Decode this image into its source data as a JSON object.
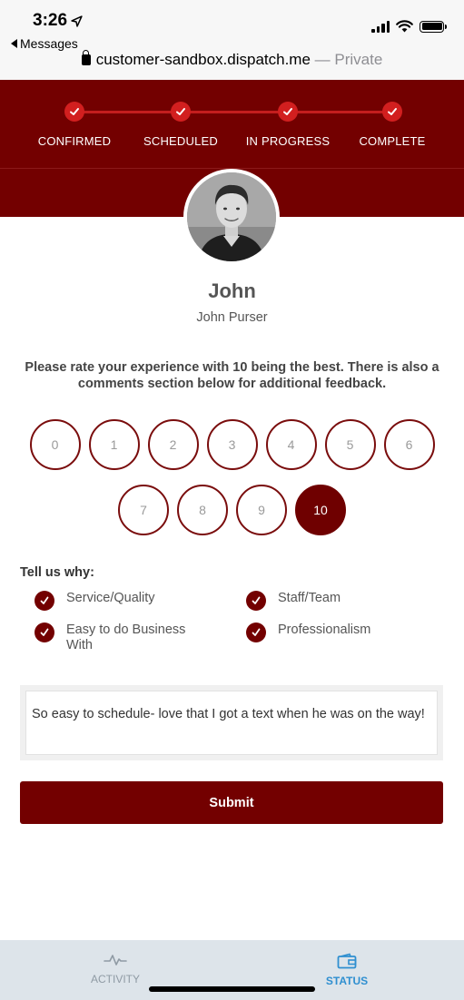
{
  "status_bar": {
    "time": "3:26",
    "back_app": "Messages",
    "url": "customer-sandbox.dispatch.me",
    "url_suffix": " — Private"
  },
  "progress": {
    "steps": [
      {
        "label": "CONFIRMED",
        "done": true
      },
      {
        "label": "SCHEDULED",
        "done": true
      },
      {
        "label": "IN PROGRESS",
        "done": true
      },
      {
        "label": "COMPLETE",
        "done": true
      }
    ]
  },
  "technician": {
    "first_name": "John",
    "full_name": "John Purser"
  },
  "survey": {
    "prompt": "Please rate your experience with 10 being the best. There is also a comments section below for additional feedback.",
    "ratings": [
      "0",
      "1",
      "2",
      "3",
      "4",
      "5",
      "6",
      "7",
      "8",
      "9",
      "10"
    ],
    "selected_rating": "10",
    "why_title": "Tell us why:",
    "reasons": [
      {
        "label": "Service/Quality",
        "checked": true
      },
      {
        "label": "Staff/Team",
        "checked": true
      },
      {
        "label": "Easy to do Business With",
        "checked": true
      },
      {
        "label": "Professionalism",
        "checked": true
      }
    ],
    "comment": "So easy to schedule- love that I got a text when he was on the way!",
    "submit_label": "Submit"
  },
  "tabs": {
    "activity": "ACTIVITY",
    "status": "STATUS",
    "active": "status"
  },
  "colors": {
    "brand": "#730000",
    "step_dot": "#d21f1f",
    "tab_active": "#2f8fd0",
    "tab_inactive": "#8f9aa4"
  }
}
